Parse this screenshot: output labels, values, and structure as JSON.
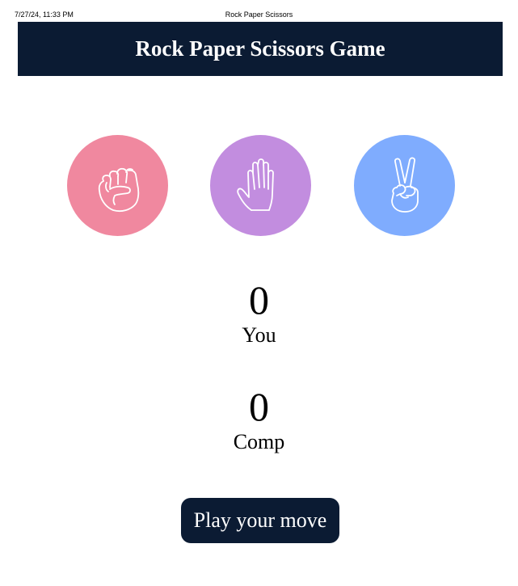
{
  "print_header": {
    "date": "7/27/24, 11:33 PM",
    "title": "Rock Paper Scissors"
  },
  "title": "Rock Paper Scissors Game",
  "choices": [
    {
      "id": "rock",
      "icon": "fist-icon",
      "color": "#f0889f"
    },
    {
      "id": "paper",
      "icon": "open-hand-icon",
      "color": "#c28ddf"
    },
    {
      "id": "scissors",
      "icon": "peace-hand-icon",
      "color": "#7facfe"
    }
  ],
  "scores": {
    "user": {
      "value": "0",
      "label": "You"
    },
    "comp": {
      "value": "0",
      "label": "Comp"
    }
  },
  "play_button": "Play your move",
  "colors": {
    "header_bg": "#0b1b33",
    "button_bg": "#0b1b33"
  }
}
